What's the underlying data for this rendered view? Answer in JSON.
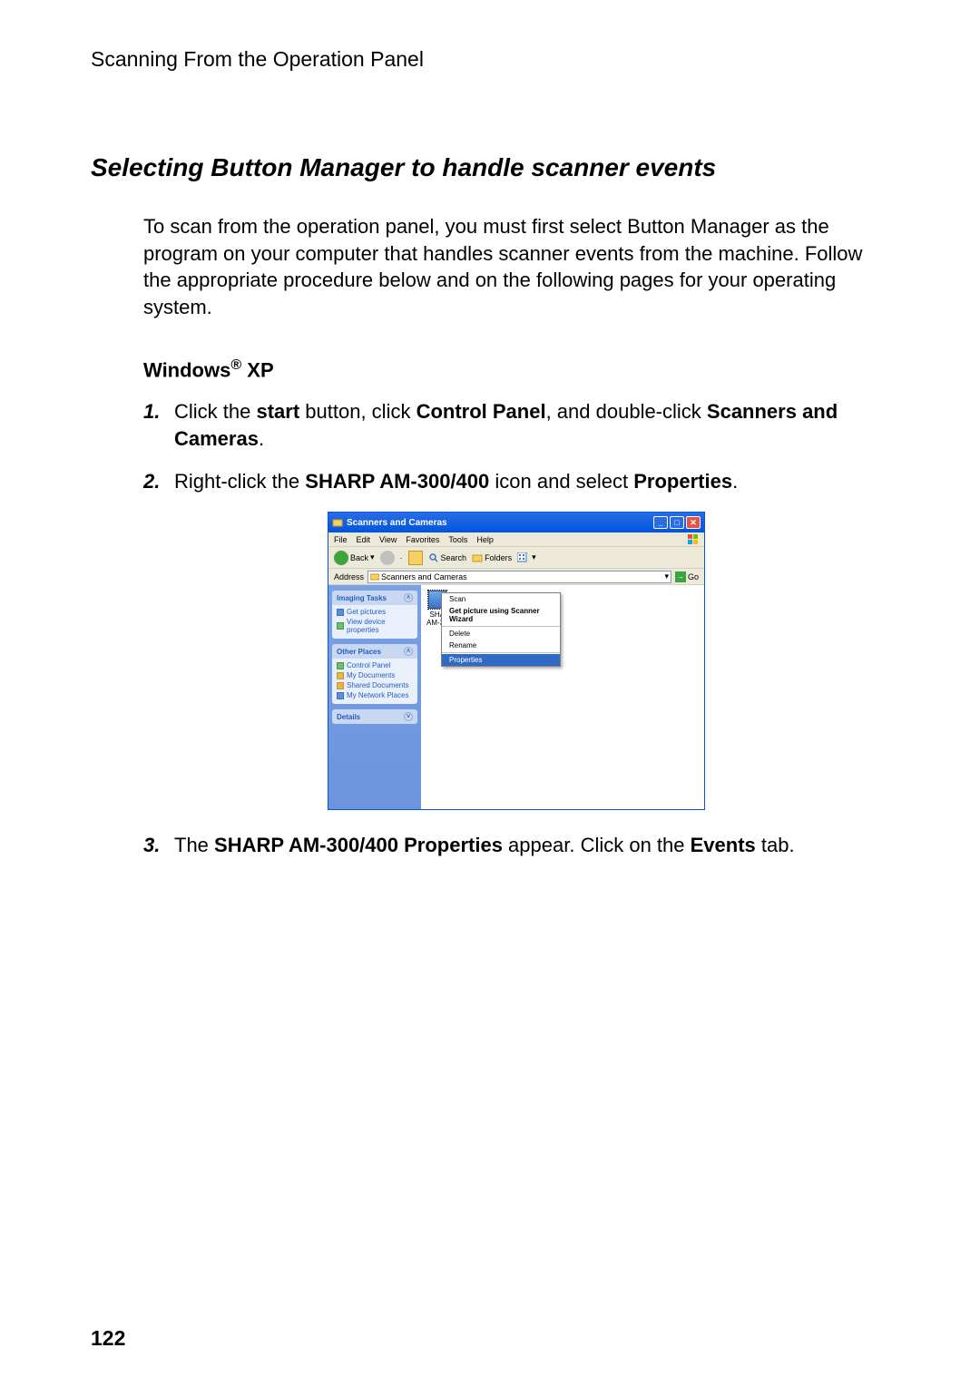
{
  "header": "Scanning From the Operation Panel",
  "section_title": "Selecting Button Manager to handle scanner events",
  "intro": "To scan from the operation panel, you must first select Button Manager as the program on your computer that handles scanner events from the machine. Follow the appropriate procedure below and on the following pages for your operating system.",
  "subhead_prefix": "Windows",
  "subhead_reg": "®",
  "subhead_suffix": " XP",
  "steps": {
    "s1": {
      "num": "1.",
      "p1": "Click the ",
      "b1": "start",
      "p2": " button, click ",
      "b2": "Control Panel",
      "p3": ", and double-click ",
      "b3": "Scanners and Cameras",
      "p4": "."
    },
    "s2": {
      "num": "2.",
      "p1": "Right-click the ",
      "b1": "SHARP AM-300/400",
      "p2": " icon and select ",
      "b2": "Properties",
      "p3": "."
    },
    "s3": {
      "num": "3.",
      "p1": "The ",
      "b1": "SHARP AM-300/400 Properties",
      "p2": " appear. Click on the ",
      "b2": "Events",
      "p3": " tab."
    }
  },
  "page_number": "122",
  "win": {
    "title": "Scanners and Cameras",
    "menus": [
      "File",
      "Edit",
      "View",
      "Favorites",
      "Tools",
      "Help"
    ],
    "toolbar": {
      "back": "Back",
      "search": "Search",
      "folders": "Folders"
    },
    "address": {
      "label": "Address",
      "value": "Scanners and Cameras",
      "go": "Go"
    },
    "panels": {
      "imaging": {
        "title": "Imaging Tasks",
        "items": [
          "Get pictures",
          "View device properties"
        ]
      },
      "places": {
        "title": "Other Places",
        "items": [
          "Control Panel",
          "My Documents",
          "Shared Documents",
          "My Network Places"
        ]
      },
      "details": {
        "title": "Details"
      }
    },
    "device": {
      "line1": "SHA",
      "line2": "AM-30"
    },
    "context": {
      "scan": "Scan",
      "wizard": "Get picture using Scanner Wizard",
      "delete": "Delete",
      "rename": "Rename",
      "properties": "Properties"
    }
  }
}
